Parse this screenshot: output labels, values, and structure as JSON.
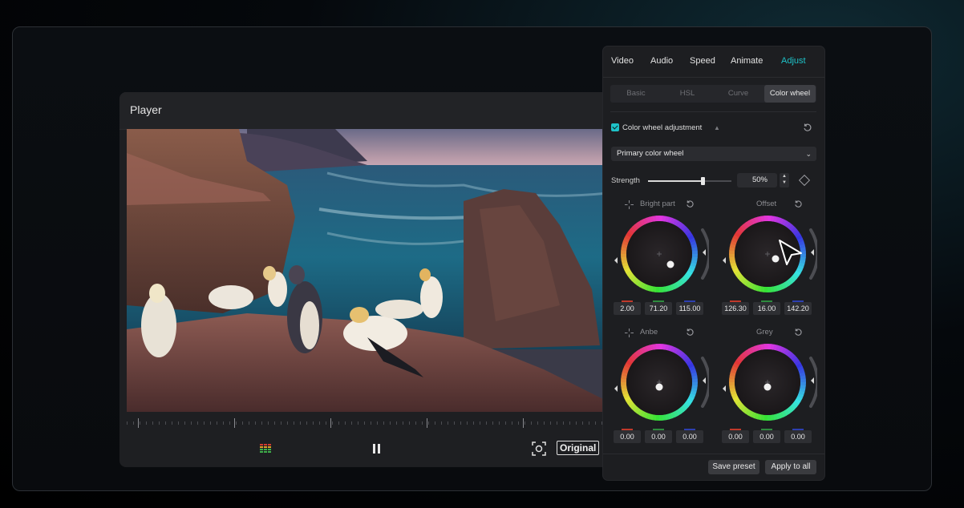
{
  "player": {
    "title": "Player",
    "original_label": "Original"
  },
  "panel": {
    "tabs": [
      "Video",
      "Audio",
      "Speed",
      "Animate",
      "Adjust"
    ],
    "active_tab": "Adjust",
    "subtabs": [
      "Basic",
      "HSL",
      "Curve",
      "Color wheel"
    ],
    "active_subtab": "Color wheel",
    "color_wheel_adjustment_label": "Color wheel adjustment",
    "dropdown_value": "Primary color wheel",
    "strength_label": "Strength",
    "strength_value": "50%",
    "strength_fraction": 0.65,
    "wheels": [
      {
        "title": "Bright part",
        "values": [
          "2.00",
          "71.20",
          "115.00"
        ]
      },
      {
        "title": "Offset",
        "values": [
          "126.30",
          "16.00",
          "142.20"
        ]
      },
      {
        "title": "Anbe",
        "values": [
          "0.00",
          "0.00",
          "0.00"
        ]
      },
      {
        "title": "Grey",
        "values": [
          "0.00",
          "0.00",
          "0.00"
        ]
      }
    ],
    "save_preset_label": "Save preset",
    "apply_to_all_label": "Apply to all"
  },
  "colors": {
    "accent": "#1ec2c8",
    "panel_bg": "#1d1e21",
    "player_bg": "#1e1f22",
    "channel_red": "#c0392b",
    "channel_green": "#2e8b3e",
    "channel_blue": "#2d3fb0"
  }
}
